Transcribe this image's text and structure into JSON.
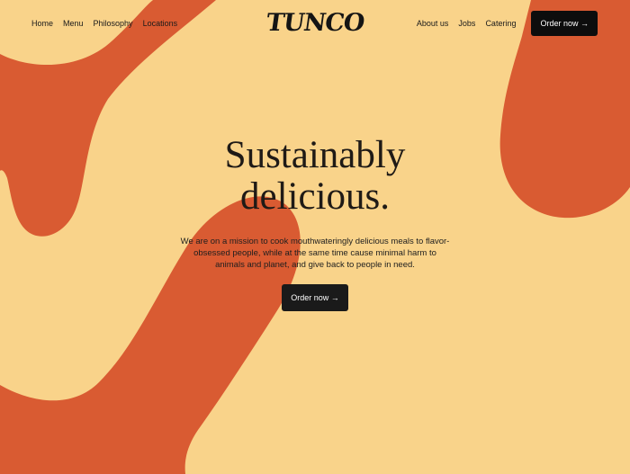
{
  "nav": {
    "left_links": [
      "Home",
      "Menu",
      "Philosophy",
      "Locations"
    ],
    "right_links": [
      "About us",
      "Jobs",
      "Catering"
    ],
    "cta_label": "Order now →"
  },
  "logo": {
    "text": "TUNCO"
  },
  "hero": {
    "title_line1": "Sustainably",
    "title_line2": "delicious.",
    "description": "We are on a mission to cook mouthwateringly delicious meals to flavor-obsessed people, while at the same time cause minimal harm to animals and planet, and give back to people in need.",
    "cta_label": "Order now →"
  },
  "colors": {
    "background": "#f9d38a",
    "shape": "#d95b32",
    "button": "#111111"
  }
}
